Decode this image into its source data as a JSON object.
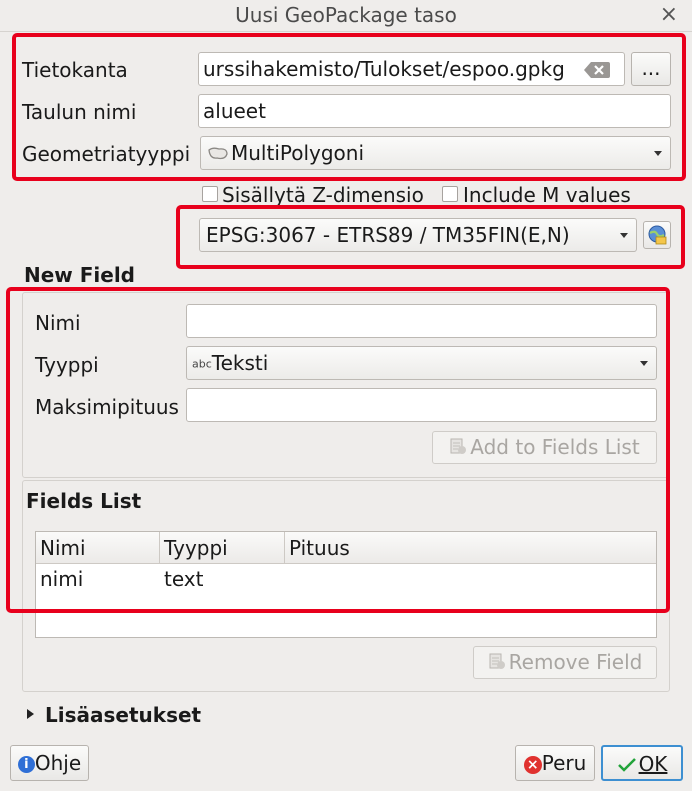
{
  "window": {
    "title": "Uusi GeoPackage taso",
    "close_glyph": "×"
  },
  "database": {
    "label": "Tietokanta",
    "value": "urssihakemisto/Tulokset/espoo.gpkg",
    "browse_label": "..."
  },
  "table_name": {
    "label": "Taulun nimi",
    "value": "alueet"
  },
  "geometry": {
    "label": "Geometriatyyppi",
    "value": "MultiPolygoni",
    "icon": "polygon-icon"
  },
  "checkboxes": {
    "z_label": "Sisällytä Z-dimensio",
    "z_checked": false,
    "m_label": "Include M values",
    "m_checked": false
  },
  "crs": {
    "value": "EPSG:3067 - ETRS89 / TM35FIN(E,N)",
    "icon": "crs-select-icon"
  },
  "new_field": {
    "heading": "New Field",
    "name_label": "Nimi",
    "name_value": "",
    "type_label": "Tyyppi",
    "type_value": "Teksti",
    "type_icon_text": "abc",
    "maxlen_label": "Maksimipituus",
    "maxlen_value": "",
    "add_button": "Add to Fields List"
  },
  "fields_list": {
    "heading": "Fields List",
    "columns": [
      "Nimi",
      "Tyyppi",
      "Pituus"
    ],
    "rows": [
      {
        "name": "nimi",
        "type": "text",
        "length": ""
      }
    ],
    "remove_button": "Remove Field"
  },
  "advanced": {
    "label": "Lisäasetukset"
  },
  "buttons": {
    "help": "Ohje",
    "cancel": "Peru",
    "ok": "OK"
  },
  "colors": {
    "highlight": "#e8001c",
    "ok_check": "#22a33a",
    "cancel_icon": "#e0322f",
    "help_icon": "#2f6fd6"
  }
}
